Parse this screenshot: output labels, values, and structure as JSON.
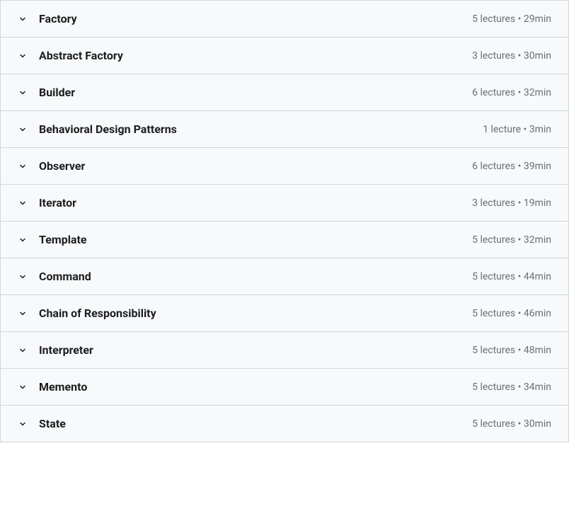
{
  "sections": [
    {
      "title": "Factory",
      "meta": "5 lectures • 29min"
    },
    {
      "title": "Abstract Factory",
      "meta": "3 lectures • 30min"
    },
    {
      "title": "Builder",
      "meta": "6 lectures • 32min"
    },
    {
      "title": "Behavioral Design Patterns",
      "meta": "1 lecture • 3min"
    },
    {
      "title": "Observer",
      "meta": "6 lectures • 39min"
    },
    {
      "title": "Iterator",
      "meta": "3 lectures • 19min"
    },
    {
      "title": "Template",
      "meta": "5 lectures • 32min"
    },
    {
      "title": "Command",
      "meta": "5 lectures • 44min"
    },
    {
      "title": "Chain of Responsibility",
      "meta": "5 lectures • 46min"
    },
    {
      "title": "Interpreter",
      "meta": "5 lectures • 48min"
    },
    {
      "title": "Memento",
      "meta": "5 lectures • 34min"
    },
    {
      "title": "State",
      "meta": "5 lectures • 30min"
    }
  ]
}
